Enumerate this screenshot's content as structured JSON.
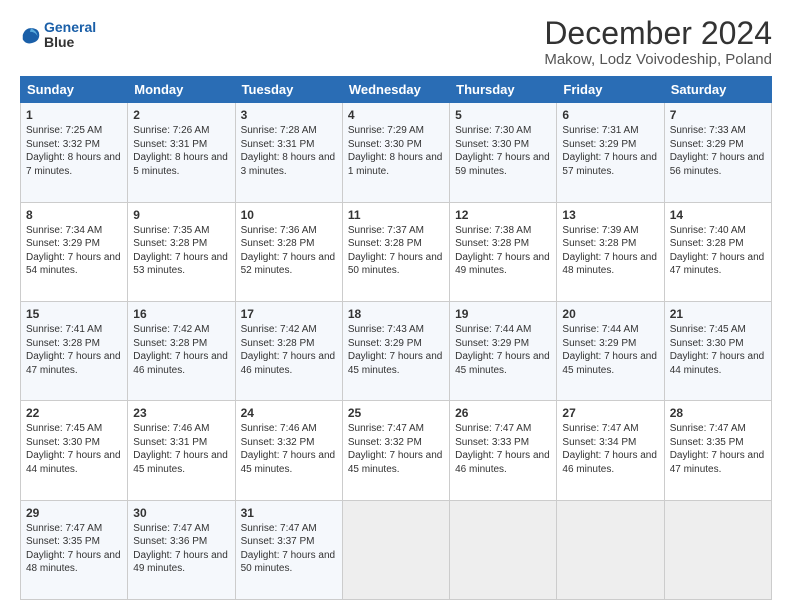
{
  "logo": {
    "line1": "General",
    "line2": "Blue"
  },
  "title": "December 2024",
  "subtitle": "Makow, Lodz Voivodeship, Poland",
  "weekdays": [
    "Sunday",
    "Monday",
    "Tuesday",
    "Wednesday",
    "Thursday",
    "Friday",
    "Saturday"
  ],
  "weeks": [
    [
      {
        "day": "1",
        "sunrise": "Sunrise: 7:25 AM",
        "sunset": "Sunset: 3:32 PM",
        "daylight": "Daylight: 8 hours and 7 minutes."
      },
      {
        "day": "2",
        "sunrise": "Sunrise: 7:26 AM",
        "sunset": "Sunset: 3:31 PM",
        "daylight": "Daylight: 8 hours and 5 minutes."
      },
      {
        "day": "3",
        "sunrise": "Sunrise: 7:28 AM",
        "sunset": "Sunset: 3:31 PM",
        "daylight": "Daylight: 8 hours and 3 minutes."
      },
      {
        "day": "4",
        "sunrise": "Sunrise: 7:29 AM",
        "sunset": "Sunset: 3:30 PM",
        "daylight": "Daylight: 8 hours and 1 minute."
      },
      {
        "day": "5",
        "sunrise": "Sunrise: 7:30 AM",
        "sunset": "Sunset: 3:30 PM",
        "daylight": "Daylight: 7 hours and 59 minutes."
      },
      {
        "day": "6",
        "sunrise": "Sunrise: 7:31 AM",
        "sunset": "Sunset: 3:29 PM",
        "daylight": "Daylight: 7 hours and 57 minutes."
      },
      {
        "day": "7",
        "sunrise": "Sunrise: 7:33 AM",
        "sunset": "Sunset: 3:29 PM",
        "daylight": "Daylight: 7 hours and 56 minutes."
      }
    ],
    [
      {
        "day": "8",
        "sunrise": "Sunrise: 7:34 AM",
        "sunset": "Sunset: 3:29 PM",
        "daylight": "Daylight: 7 hours and 54 minutes."
      },
      {
        "day": "9",
        "sunrise": "Sunrise: 7:35 AM",
        "sunset": "Sunset: 3:28 PM",
        "daylight": "Daylight: 7 hours and 53 minutes."
      },
      {
        "day": "10",
        "sunrise": "Sunrise: 7:36 AM",
        "sunset": "Sunset: 3:28 PM",
        "daylight": "Daylight: 7 hours and 52 minutes."
      },
      {
        "day": "11",
        "sunrise": "Sunrise: 7:37 AM",
        "sunset": "Sunset: 3:28 PM",
        "daylight": "Daylight: 7 hours and 50 minutes."
      },
      {
        "day": "12",
        "sunrise": "Sunrise: 7:38 AM",
        "sunset": "Sunset: 3:28 PM",
        "daylight": "Daylight: 7 hours and 49 minutes."
      },
      {
        "day": "13",
        "sunrise": "Sunrise: 7:39 AM",
        "sunset": "Sunset: 3:28 PM",
        "daylight": "Daylight: 7 hours and 48 minutes."
      },
      {
        "day": "14",
        "sunrise": "Sunrise: 7:40 AM",
        "sunset": "Sunset: 3:28 PM",
        "daylight": "Daylight: 7 hours and 47 minutes."
      }
    ],
    [
      {
        "day": "15",
        "sunrise": "Sunrise: 7:41 AM",
        "sunset": "Sunset: 3:28 PM",
        "daylight": "Daylight: 7 hours and 47 minutes."
      },
      {
        "day": "16",
        "sunrise": "Sunrise: 7:42 AM",
        "sunset": "Sunset: 3:28 PM",
        "daylight": "Daylight: 7 hours and 46 minutes."
      },
      {
        "day": "17",
        "sunrise": "Sunrise: 7:42 AM",
        "sunset": "Sunset: 3:28 PM",
        "daylight": "Daylight: 7 hours and 46 minutes."
      },
      {
        "day": "18",
        "sunrise": "Sunrise: 7:43 AM",
        "sunset": "Sunset: 3:29 PM",
        "daylight": "Daylight: 7 hours and 45 minutes."
      },
      {
        "day": "19",
        "sunrise": "Sunrise: 7:44 AM",
        "sunset": "Sunset: 3:29 PM",
        "daylight": "Daylight: 7 hours and 45 minutes."
      },
      {
        "day": "20",
        "sunrise": "Sunrise: 7:44 AM",
        "sunset": "Sunset: 3:29 PM",
        "daylight": "Daylight: 7 hours and 45 minutes."
      },
      {
        "day": "21",
        "sunrise": "Sunrise: 7:45 AM",
        "sunset": "Sunset: 3:30 PM",
        "daylight": "Daylight: 7 hours and 44 minutes."
      }
    ],
    [
      {
        "day": "22",
        "sunrise": "Sunrise: 7:45 AM",
        "sunset": "Sunset: 3:30 PM",
        "daylight": "Daylight: 7 hours and 44 minutes."
      },
      {
        "day": "23",
        "sunrise": "Sunrise: 7:46 AM",
        "sunset": "Sunset: 3:31 PM",
        "daylight": "Daylight: 7 hours and 45 minutes."
      },
      {
        "day": "24",
        "sunrise": "Sunrise: 7:46 AM",
        "sunset": "Sunset: 3:32 PM",
        "daylight": "Daylight: 7 hours and 45 minutes."
      },
      {
        "day": "25",
        "sunrise": "Sunrise: 7:47 AM",
        "sunset": "Sunset: 3:32 PM",
        "daylight": "Daylight: 7 hours and 45 minutes."
      },
      {
        "day": "26",
        "sunrise": "Sunrise: 7:47 AM",
        "sunset": "Sunset: 3:33 PM",
        "daylight": "Daylight: 7 hours and 46 minutes."
      },
      {
        "day": "27",
        "sunrise": "Sunrise: 7:47 AM",
        "sunset": "Sunset: 3:34 PM",
        "daylight": "Daylight: 7 hours and 46 minutes."
      },
      {
        "day": "28",
        "sunrise": "Sunrise: 7:47 AM",
        "sunset": "Sunset: 3:35 PM",
        "daylight": "Daylight: 7 hours and 47 minutes."
      }
    ],
    [
      {
        "day": "29",
        "sunrise": "Sunrise: 7:47 AM",
        "sunset": "Sunset: 3:35 PM",
        "daylight": "Daylight: 7 hours and 48 minutes."
      },
      {
        "day": "30",
        "sunrise": "Sunrise: 7:47 AM",
        "sunset": "Sunset: 3:36 PM",
        "daylight": "Daylight: 7 hours and 49 minutes."
      },
      {
        "day": "31",
        "sunrise": "Sunrise: 7:47 AM",
        "sunset": "Sunset: 3:37 PM",
        "daylight": "Daylight: 7 hours and 50 minutes."
      },
      null,
      null,
      null,
      null
    ]
  ]
}
